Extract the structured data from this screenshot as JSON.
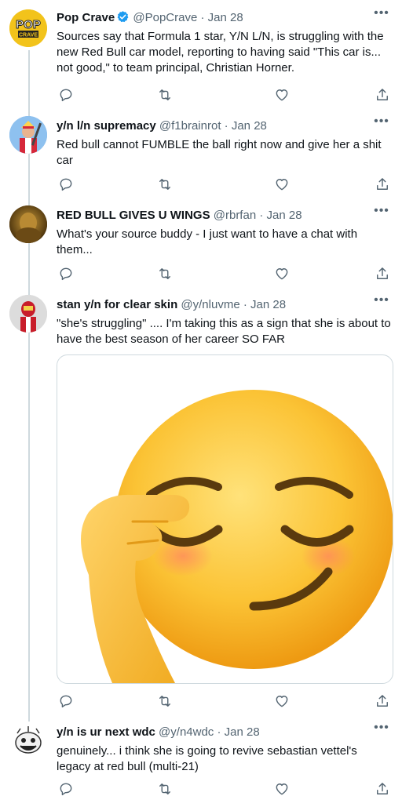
{
  "tweets": [
    {
      "name": "Pop Crave",
      "handle": "@PopCrave",
      "sep": "·",
      "date": "Jan 28",
      "text": "Sources say that Formula 1 star, Y/N L/N, is struggling with the new Red Bull car model, reporting to having said \"This car is... not good,\" to team principal, Christian Horner.",
      "avatar_text": "POP\nCRAVE"
    },
    {
      "name": "y/n l/n supremacy",
      "handle": "@f1brainrot",
      "sep": "·",
      "date": "Jan 28",
      "text": "Red bull cannot FUMBLE the ball right now and give her a shit car"
    },
    {
      "name": "RED BULL GIVES U WINGS",
      "handle": "@rbrfan",
      "sep": "·",
      "date": "Jan 28",
      "text": "What's your source buddy - I just want to have a chat with them..."
    },
    {
      "name": "stan y/n for clear skin",
      "handle": "@y/nluvme",
      "sep": "·",
      "date": "Jan 28",
      "text": "\"she's struggling\" .... I'm taking this as a sign that she is about to have the best season of her career SO FAR"
    },
    {
      "name": "y/n is ur next wdc",
      "handle": "@y/n4wdc",
      "sep": "·",
      "date": "Jan 28",
      "text": "genuinely... i think she is going to revive sebastian vettel's legacy at red bull (multi-21)"
    }
  ],
  "more_label": "•••",
  "colors": {
    "text": "#0f1419",
    "secondary": "#536471",
    "verified": "#1d9bf0",
    "pop_crave_yellow": "#f2c31b",
    "thread_line": "#cfd9de"
  },
  "icons": [
    "reply-icon",
    "retweet-icon",
    "like-icon",
    "share-icon",
    "verified-badge-icon",
    "more-icon"
  ]
}
